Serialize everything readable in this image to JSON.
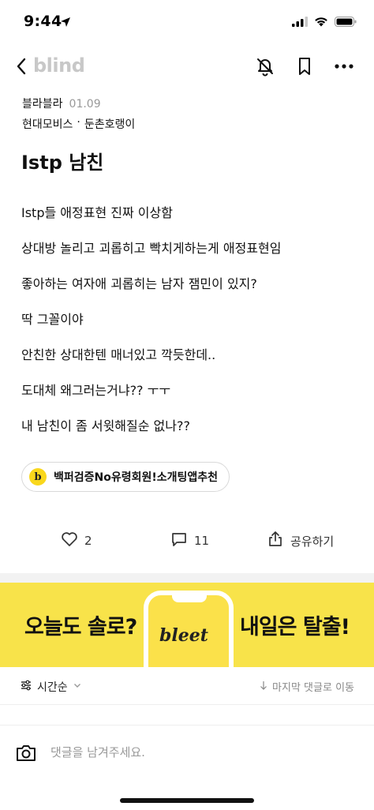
{
  "status_bar": {
    "time": "9:44",
    "icons": [
      "location-arrow-icon",
      "signal-icon",
      "wifi-icon",
      "battery-icon"
    ]
  },
  "nav": {
    "brand": "blind",
    "icons": [
      "back-chevron-icon",
      "bell-off-icon",
      "bookmark-icon",
      "more-icon"
    ]
  },
  "post": {
    "author": "블라블라",
    "date": "01.09",
    "company": "현대모비스",
    "separator": "·",
    "nickname": "둔촌호랭이",
    "title": "Istp 남친",
    "body_lines": [
      "Istp들 애정표현 진짜 이상함",
      "상대방 놀리고 괴롭히고 빡치게하는게 애정표현임",
      "좋아하는 여자애 괴롭히는 남자 잼민이 있지?",
      "딱 그꼴이야",
      "안친한 상대한텐 매너있고 깍듯한데..",
      "도대체 왜그러는거냐?? ㅜㅜ",
      "내 남친이 좀 서윗해질순 없나??"
    ]
  },
  "ad_chip": {
    "logo_letter": "b",
    "label": "백퍼검증No유령회원!소개팅앱추천"
  },
  "actions": {
    "like_count": "2",
    "comment_count": "11",
    "share_label": "공유하기"
  },
  "banner": {
    "left_text": "오늘도 솔로?",
    "brand": "bleet",
    "right_text": "내일은 탈출!",
    "background": "#f8e34a"
  },
  "comments": {
    "sort_label": "시간순",
    "jump_label": "마지막 댓글로 이동",
    "input_placeholder": "댓글을 남겨주세요."
  },
  "colors": {
    "brand_gray": "#c8c8c8",
    "accent_yellow": "#f9d71c",
    "muted_text": "#999999"
  }
}
